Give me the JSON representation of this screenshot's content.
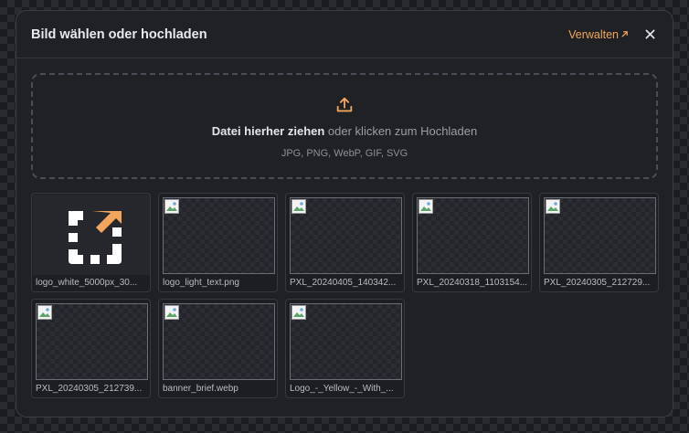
{
  "modal": {
    "title": "Bild wählen oder hochladen",
    "manage_label": "Verwalten",
    "accent_color": "#f2a55c"
  },
  "dropzone": {
    "text_bold": "Datei hierher ziehen",
    "text_rest": " oder klicken zum Hochladen",
    "formats": "JPG, PNG, WebP, GIF, SVG"
  },
  "images": [
    {
      "name": "logo_white_5000px_30...",
      "icon": "brand-logo"
    },
    {
      "name": "logo_light_text.png",
      "icon": "broken-image"
    },
    {
      "name": "PXL_20240405_140342...",
      "icon": "broken-image"
    },
    {
      "name": "PXL_20240318_1103154...",
      "icon": "broken-image"
    },
    {
      "name": "PXL_20240305_212729...",
      "icon": "broken-image"
    },
    {
      "name": "PXL_20240305_212739...",
      "icon": "broken-image"
    },
    {
      "name": "banner_brief.webp",
      "icon": "broken-image"
    },
    {
      "name": "Logo_-_Yellow_-_With_...",
      "icon": "broken-image"
    }
  ]
}
